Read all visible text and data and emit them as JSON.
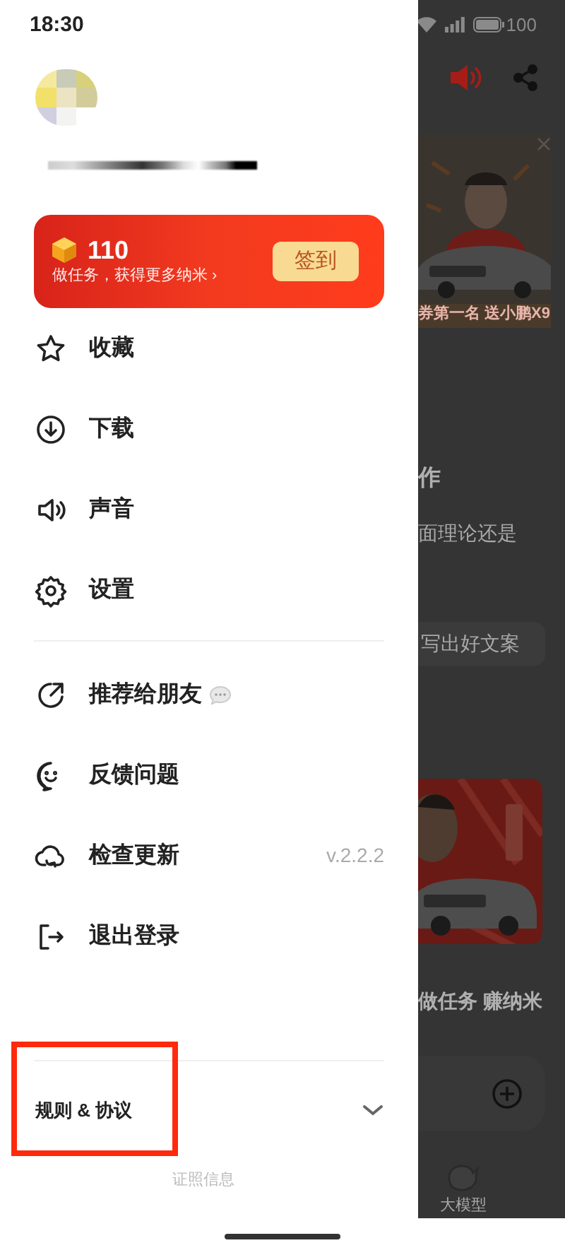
{
  "status_bar": {
    "time": "18:30",
    "battery": "100"
  },
  "points_card": {
    "points": "110",
    "subtitle": "做任务，获得更多纳米 ›",
    "button": "签到"
  },
  "menu_sections": [
    [
      {
        "label": "收藏"
      },
      {
        "label": "下载"
      },
      {
        "label": "声音"
      },
      {
        "label": "设置"
      }
    ],
    [
      {
        "label": "推荐给朋友",
        "chat_badge": true
      },
      {
        "label": "反馈问题"
      },
      {
        "label": "检查更新",
        "value": "v.2.2.2"
      },
      {
        "label": "退出登录"
      }
    ]
  ],
  "footer": {
    "rules_label": "规则 & 协议",
    "expanded": false,
    "license": "证照信息"
  },
  "background": {
    "ad_caption": "券第一名 送小鹏X9",
    "heading": "作",
    "question": "面理论还是",
    "chip": "写出好文案",
    "task_caption": "做任务 赚纳米",
    "tab_label": "大模型"
  }
}
